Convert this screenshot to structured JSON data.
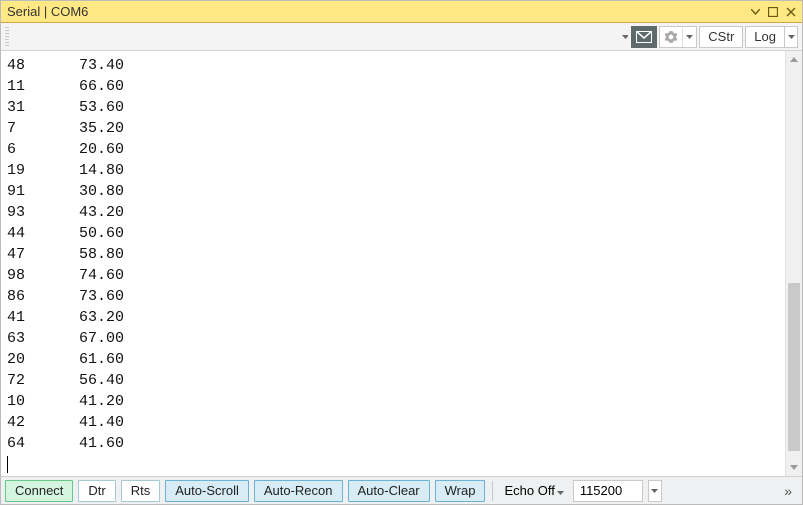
{
  "title": "Serial | COM6",
  "toolbar_top": {
    "cstr_label": "CStr",
    "log_label": "Log"
  },
  "terminal": {
    "rows": [
      {
        "c1": "48",
        "c2": "73.40"
      },
      {
        "c1": "11",
        "c2": "66.60"
      },
      {
        "c1": "31",
        "c2": "53.60"
      },
      {
        "c1": "7",
        "c2": "35.20"
      },
      {
        "c1": "6",
        "c2": "20.60"
      },
      {
        "c1": "19",
        "c2": "14.80"
      },
      {
        "c1": "91",
        "c2": "30.80"
      },
      {
        "c1": "93",
        "c2": "43.20"
      },
      {
        "c1": "44",
        "c2": "50.60"
      },
      {
        "c1": "47",
        "c2": "58.80"
      },
      {
        "c1": "98",
        "c2": "74.60"
      },
      {
        "c1": "86",
        "c2": "73.60"
      },
      {
        "c1": "41",
        "c2": "63.20"
      },
      {
        "c1": "63",
        "c2": "67.00"
      },
      {
        "c1": "20",
        "c2": "61.60"
      },
      {
        "c1": "72",
        "c2": "56.40"
      },
      {
        "c1": "10",
        "c2": "41.20"
      },
      {
        "c1": "42",
        "c2": "41.40"
      },
      {
        "c1": "64",
        "c2": "41.60"
      }
    ]
  },
  "toolbar_bottom": {
    "connect": "Connect",
    "dtr": "Dtr",
    "rts": "Rts",
    "autoscroll": "Auto-Scroll",
    "autorecon": "Auto-Recon",
    "autoclear": "Auto-Clear",
    "wrap": "Wrap",
    "echo": "Echo Off",
    "baud": "115200"
  },
  "colors": {
    "title_bg": "#ffe985",
    "connect_active": "#d5f5e0",
    "toggled": "#d7ecf5"
  }
}
